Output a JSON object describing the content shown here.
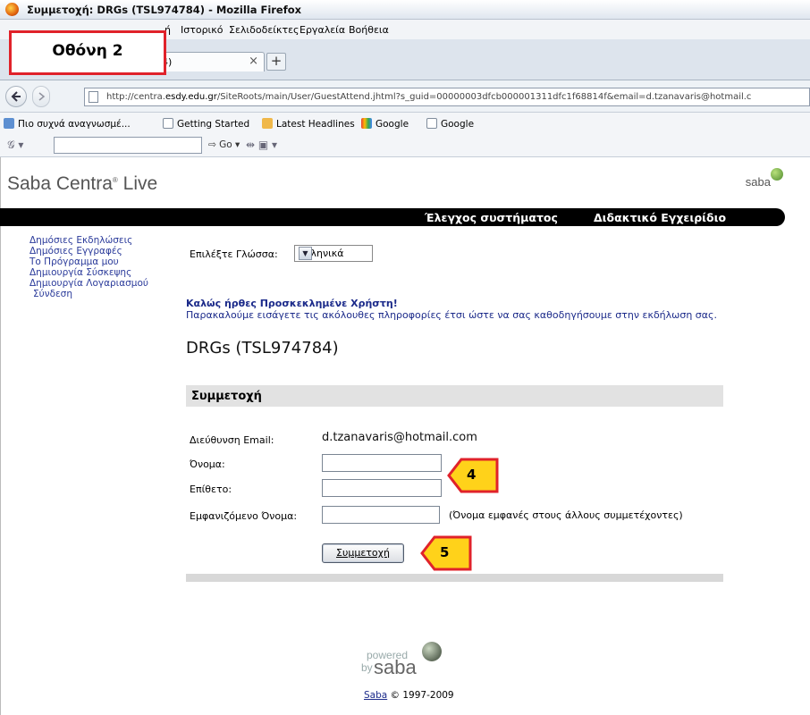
{
  "browser": {
    "window_title": "Συμμετοχή: DRGs (TSL974784) - Mozilla Firefox",
    "menus": [
      "Ιστορικό",
      "Σελιδοδείκτες",
      "Εργαλεία",
      "Βοήθεια"
    ],
    "menu_partial": "ή",
    "tab_title": "4)",
    "tab_close": "×",
    "new_tab": "+",
    "url_prefix": "http://centra.",
    "url_domain": "esdy.edu.gr",
    "url_rest": "/SiteRoots/main/User/GuestAttend.jhtml?s_guid=00000003dfcb000001311dfc1f68814f&email=d.tzanavaris@hotmail.c",
    "bookmarks": [
      "Πιο συχνά αναγνωσμέ...",
      "Getting Started",
      "Latest Headlines",
      "Google",
      "Google"
    ],
    "toolbar_go": "Go"
  },
  "callouts": {
    "screen_label": "Οθόνη 2",
    "step4": "4",
    "step5": "5"
  },
  "page": {
    "brand": "Saba Centra",
    "brand_suffix": "Live",
    "brand_tm": "®",
    "logo_small": "saba",
    "topnav": [
      "Έλεγχος συστήματος",
      "Διδακτικό Εγχειρίδιο"
    ],
    "sidenav": [
      "Δημόσιες Εκδηλώσεις",
      "Δημόσιες Εγγραφές",
      "Το Πρόγραμμα μου",
      "Δημιουργία Σύσκεψης",
      "Δημιουργία Λογαριασμού",
      "Σύνδεση"
    ],
    "language_label": "Επιλέξτε Γλώσσα:",
    "language_value": "Ελληνικά",
    "welcome": "Καλώς ήρθες Προσκεκλημένε Χρήστη!",
    "instructions": "Παρακαλούμε εισάγετε τις ακόλουθες πληροφορίες έτσι ώστε να σας καθοδηγήσουμε στην εκδήλωση σας.",
    "event_title": "DRGs (TSL974784)",
    "section_title": "Συμμετοχή",
    "form": {
      "email_label": "Διεύθυνση Email:",
      "email_value": "d.tzanavaris@hotmail.com",
      "first_name_label": "Όνομα:",
      "first_name_value": "",
      "last_name_label": "Επίθετο:",
      "last_name_value": "",
      "display_name_label": "Εμφανιζόμενο Όνομα:",
      "display_name_value": "",
      "display_name_hint": "(Όνομα εμφανές στους άλλους συμμετέχοντες)",
      "submit_label": "Συμμετοχή"
    },
    "footer": {
      "powered": "powered",
      "by": "by",
      "saba": "saba",
      "copyright_link": "Saba",
      "copyright_text": " © 1997-2009"
    }
  },
  "colors": {
    "link": "#1b2a8a",
    "callout_red": "#e0222a",
    "callout_yellow": "#ffd21a"
  }
}
